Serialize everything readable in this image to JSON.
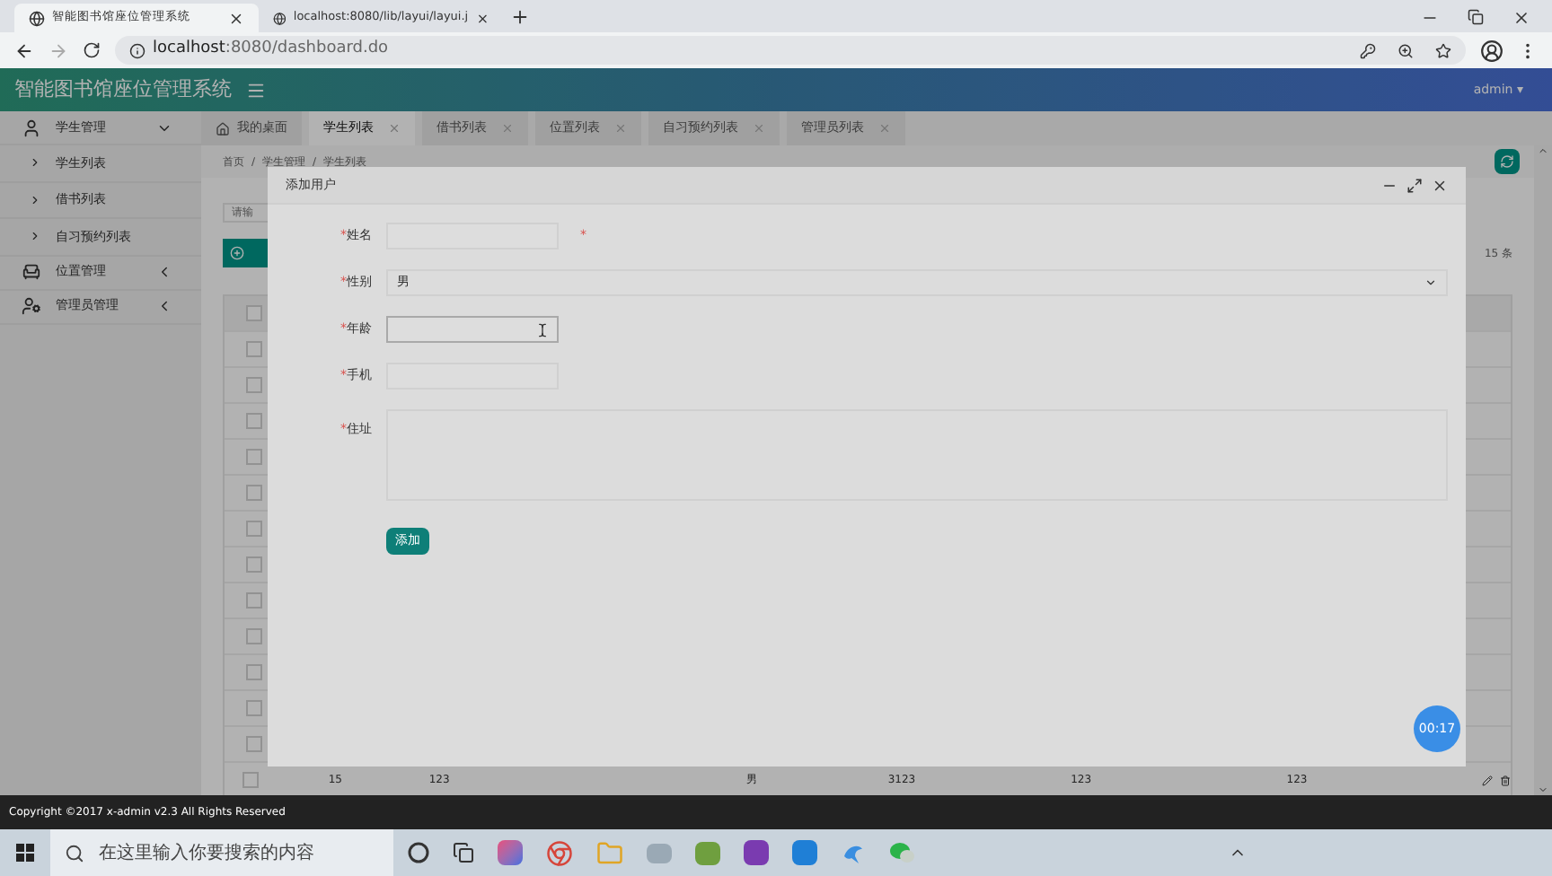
{
  "browser": {
    "tabs": [
      {
        "title": "智能图书馆座位管理系统",
        "selected": true
      },
      {
        "title": "localhost:8080/lib/layui/layui.j",
        "selected": false
      }
    ],
    "url_host": "localhost",
    "url_rest": ":8080/dashboard.do"
  },
  "header": {
    "title": "智能图书馆座位管理系统",
    "user": "admin",
    "caret": "▾"
  },
  "sidebar": {
    "items": [
      {
        "label": "学生管理",
        "expanded": true,
        "children": [
          {
            "label": "学生列表"
          },
          {
            "label": "借书列表"
          },
          {
            "label": "自习预约列表"
          }
        ]
      },
      {
        "label": "位置管理",
        "expanded": false
      },
      {
        "label": "管理员管理",
        "expanded": false
      }
    ]
  },
  "tabs": [
    {
      "label": "我的桌面",
      "selected": false,
      "closable": false
    },
    {
      "label": "学生列表",
      "selected": true,
      "closable": true
    },
    {
      "label": "借书列表",
      "selected": false,
      "closable": true
    },
    {
      "label": "位置列表",
      "selected": false,
      "closable": true
    },
    {
      "label": "自习预约列表",
      "selected": false,
      "closable": true
    },
    {
      "label": "管理员列表",
      "selected": false,
      "closable": true
    }
  ],
  "breadcrumb": [
    "首页",
    "学生管理",
    "学生列表"
  ],
  "breadcrumb_separator": "/",
  "search": {
    "placeholder": "请输"
  },
  "total": "15 条",
  "table": {
    "rows": [
      {
        "checked": false
      },
      {
        "checked": false
      },
      {
        "checked": false
      },
      {
        "checked": false
      },
      {
        "checked": false
      },
      {
        "checked": false
      },
      {
        "checked": false
      },
      {
        "checked": false
      },
      {
        "checked": false
      },
      {
        "checked": false
      },
      {
        "checked": false
      },
      {
        "checked": false
      },
      {
        "checked": false
      },
      {
        "checked": false,
        "cells": [
          "15",
          "123",
          "男",
          "3123",
          "123",
          "123"
        ]
      }
    ]
  },
  "dialog": {
    "title": "添加用户",
    "fields": [
      {
        "kind": "input",
        "label": "姓名",
        "required_mark": "*",
        "trailing_mark": "*"
      },
      {
        "kind": "select",
        "label": "性别",
        "required_mark": "*",
        "value": "男"
      },
      {
        "kind": "input",
        "label": "年龄",
        "required_mark": "*",
        "focused": true
      },
      {
        "kind": "input",
        "label": "手机",
        "required_mark": "*"
      },
      {
        "kind": "textarea",
        "label": "住址",
        "required_mark": "*"
      }
    ],
    "submit": "添加"
  },
  "timer": "00:17",
  "footer": "Copyright ©2017 x-admin v2.3 All Rights Reserved",
  "taskbar": {
    "search_placeholder": "在这里输入你要搜索的内容"
  }
}
